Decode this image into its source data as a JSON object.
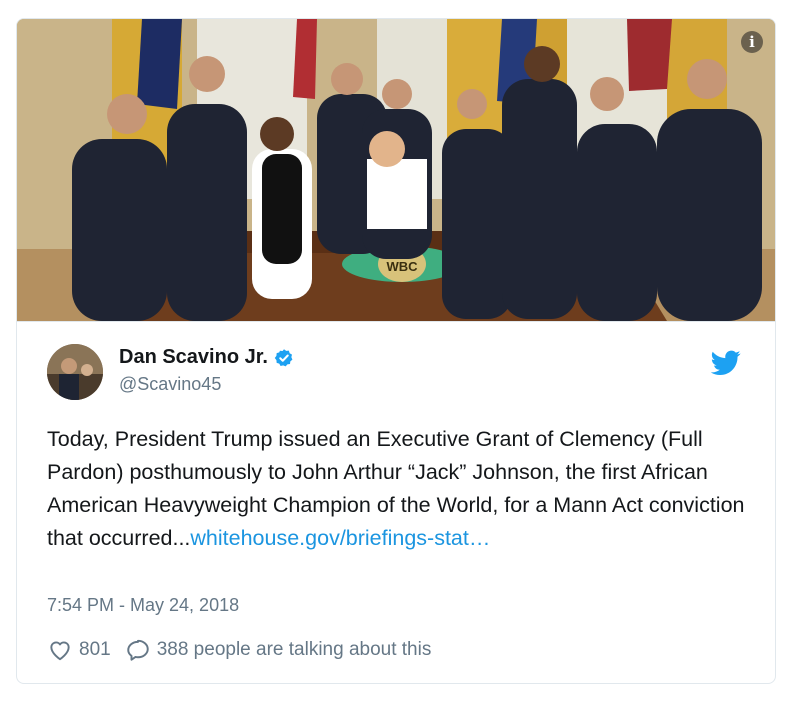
{
  "media": {
    "belt_text": "WBC",
    "info_icon_glyph": "i"
  },
  "author": {
    "display_name": "Dan Scavino Jr.",
    "handle": "@Scavino45",
    "verified": true
  },
  "tweet": {
    "text": "Today, President Trump issued an Executive Grant of Clemency (Full Pardon) posthumously to John Arthur “Jack” Johnson, the first African American Heavyweight Champion of the World, for a Mann Act conviction that occurred...",
    "link_text": "whitehouse.gov/briefings-stat…"
  },
  "timestamp": "7:54 PM - May 24, 2018",
  "actions": {
    "likes": "801",
    "talking": "388 people are talking about this"
  },
  "colors": {
    "twitter_blue": "#1da1f2",
    "link": "#1b95e0",
    "secondary_text": "#657786",
    "border": "#e1e8ed"
  },
  "icons": {
    "info": "info-icon",
    "verified": "verified-badge-icon",
    "twitter": "twitter-bird-icon",
    "like": "heart-icon",
    "reply": "speech-bubble-icon"
  }
}
